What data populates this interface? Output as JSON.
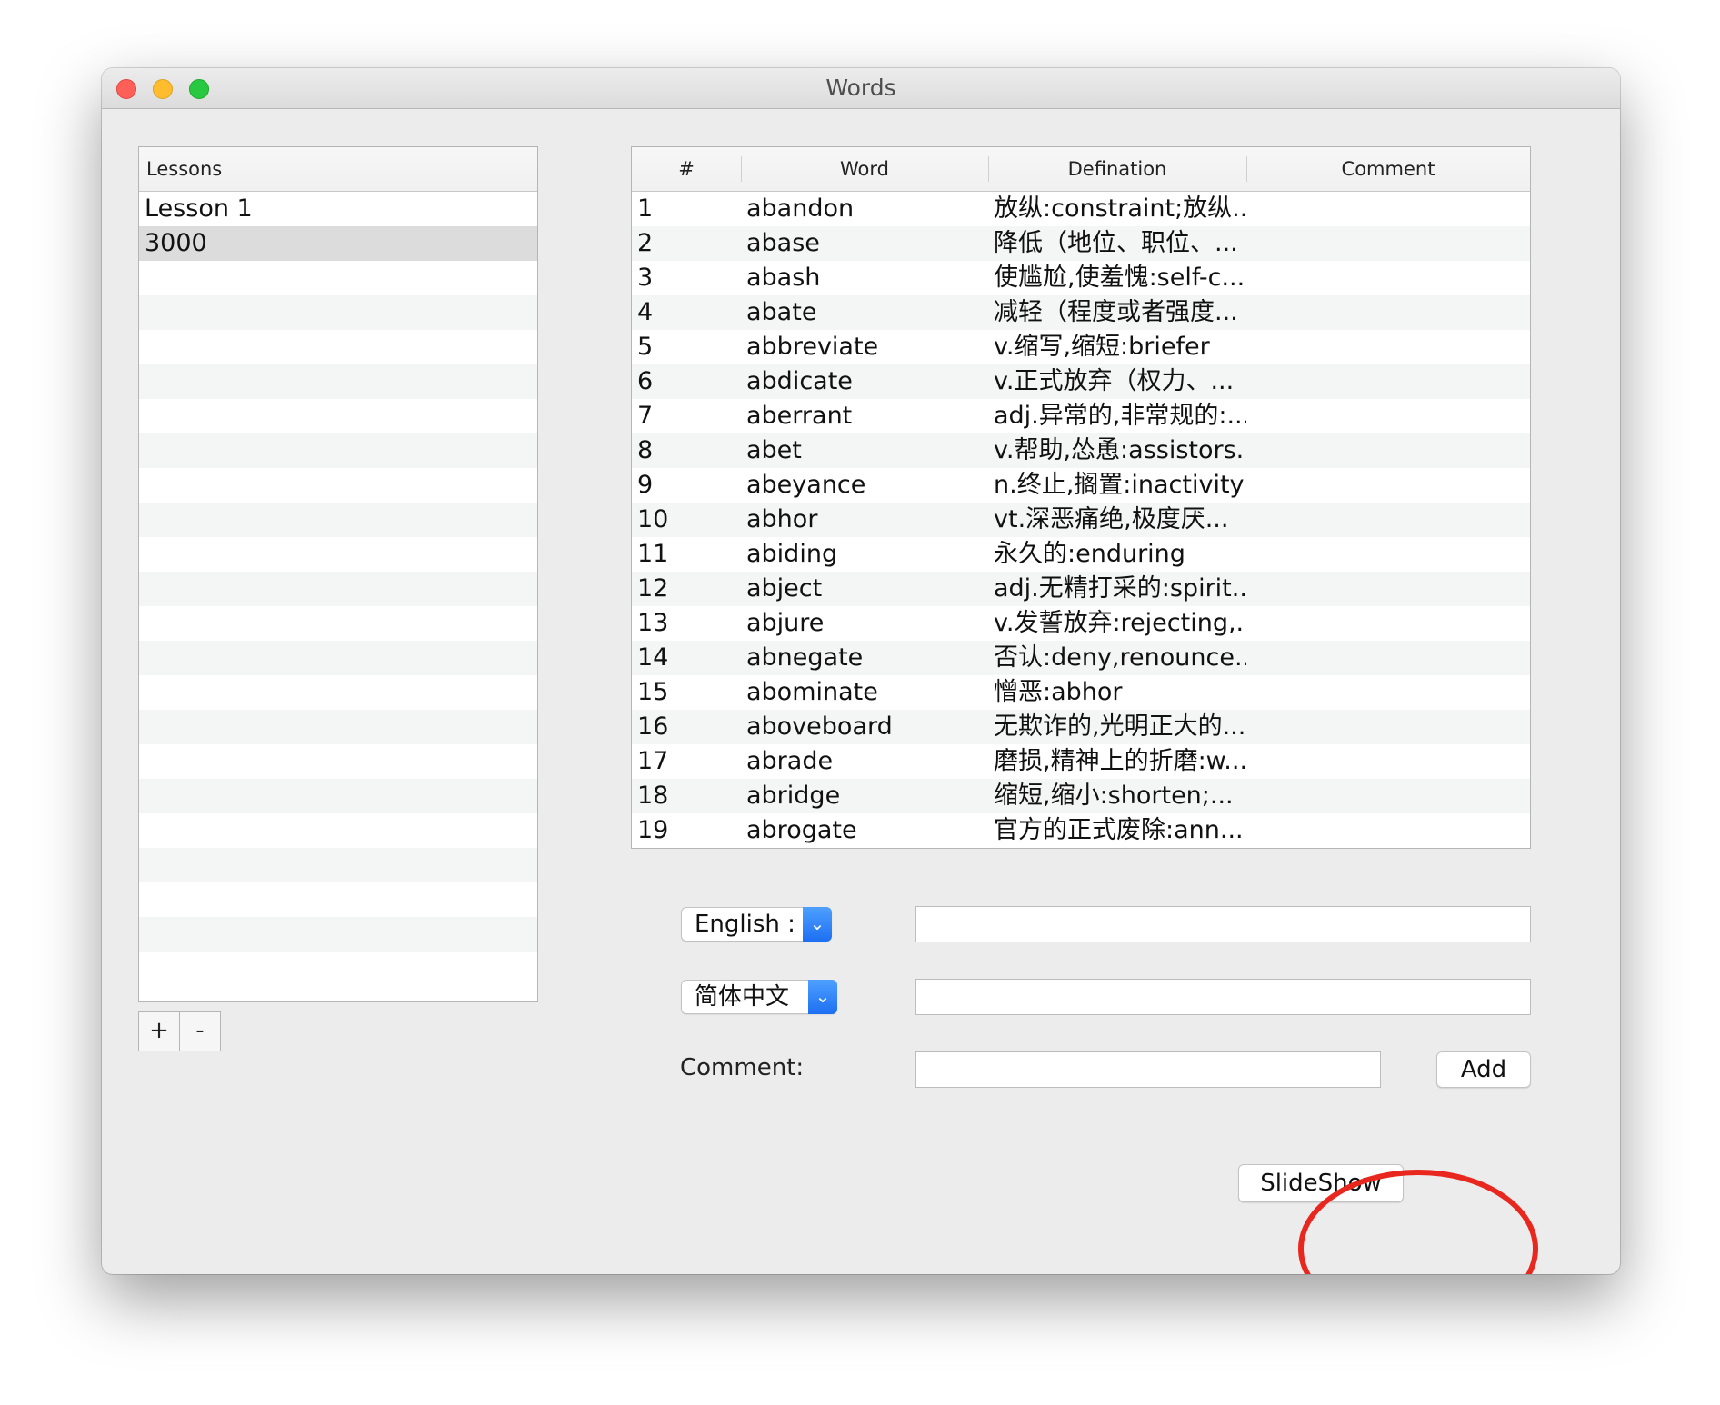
{
  "window": {
    "title": "Words"
  },
  "lessons": {
    "header": "Lessons",
    "items": [
      {
        "label": "Lesson 1",
        "selected": false
      },
      {
        "label": "3000",
        "selected": true
      }
    ],
    "add_label": "+",
    "remove_label": "-"
  },
  "table": {
    "columns": [
      "#",
      "Word",
      "Defination",
      "Comment"
    ],
    "rows": [
      [
        "1",
        "abandon",
        "放纵:constraint;放纵...",
        ""
      ],
      [
        "2",
        "abase",
        "降低（地位、职位、...",
        ""
      ],
      [
        "3",
        "abash",
        "使尴尬,使羞愧:self-c...",
        ""
      ],
      [
        "4",
        "abate",
        "减轻（程度或者强度...",
        ""
      ],
      [
        "5",
        "abbreviate",
        "v.缩写,缩短:briefer",
        ""
      ],
      [
        "6",
        "abdicate",
        "v.正式放弃（权力、...",
        ""
      ],
      [
        "7",
        "aberrant",
        "adj.异常的,非常规的:...",
        ""
      ],
      [
        "8",
        "abet",
        "v.帮助,怂恿:assistors...",
        ""
      ],
      [
        "9",
        "abeyance",
        "n.终止,搁置:inactivity",
        ""
      ],
      [
        "10",
        "abhor",
        "vt.深恶痛绝,极度厌...",
        ""
      ],
      [
        "11",
        "abiding",
        "永久的:enduring",
        ""
      ],
      [
        "12",
        "abject",
        "adj.无精打采的:spirit...",
        ""
      ],
      [
        "13",
        "abjure",
        "v.发誓放弃:rejecting,...",
        ""
      ],
      [
        "14",
        "abnegate",
        "否认:deny,renounce...",
        ""
      ],
      [
        "15",
        "abominate",
        "憎恶:abhor",
        ""
      ],
      [
        "16",
        "aboveboard",
        "无欺诈的,光明正大的...",
        ""
      ],
      [
        "17",
        "abrade",
        "磨损,精神上的折磨:w...",
        ""
      ],
      [
        "18",
        "abridge",
        "缩短,缩小:shorten;...",
        ""
      ],
      [
        "19",
        "abrogate",
        "官方的正式废除:ann...",
        ""
      ]
    ]
  },
  "form": {
    "english_dropdown": "English :",
    "chinese_dropdown": "简体中文",
    "dropdown_icon": "chevron-down-icon",
    "english_value": "",
    "chinese_value": "",
    "comment_label": "Comment:",
    "comment_value": "",
    "add_label": "Add",
    "slideshow_label": "SlideShow"
  },
  "colors": {
    "accent": "#1d6ff2",
    "highlight_ring": "#e8281e",
    "traffic_close": "#fe5f57",
    "traffic_minimize": "#febc2e",
    "traffic_maximize": "#28c840"
  }
}
